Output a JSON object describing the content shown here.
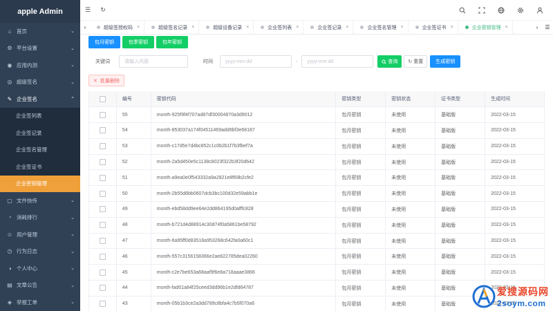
{
  "app": {
    "title": "apple Admin"
  },
  "sidebar": {
    "items_before": [
      {
        "label": "首页",
        "icon": "home-icon"
      },
      {
        "label": "平台设置",
        "icon": "settings-icon"
      },
      {
        "label": "应用内测",
        "icon": "app-icon"
      },
      {
        "label": "超级签名",
        "icon": "sign-icon"
      }
    ],
    "open_group": {
      "label": "企业签名",
      "icon": "edit-icon",
      "children": [
        {
          "label": "企业签列表",
          "active": false
        },
        {
          "label": "企业签记录",
          "active": false
        },
        {
          "label": "企业签名管理",
          "active": false
        },
        {
          "label": "企业签证书",
          "active": false
        },
        {
          "label": "企业密钥管理",
          "active": true
        }
      ]
    },
    "items_after": [
      {
        "label": "文件快传",
        "icon": "file-icon"
      },
      {
        "label": "消耗排行",
        "icon": "rank-icon"
      },
      {
        "label": "用户管理",
        "icon": "user-icon"
      },
      {
        "label": "行为日志",
        "icon": "log-icon"
      },
      {
        "label": "个人中心",
        "icon": "profile-icon"
      },
      {
        "label": "文章公告",
        "icon": "article-icon"
      },
      {
        "label": "举报工单",
        "icon": "report-icon"
      }
    ]
  },
  "tags": [
    {
      "label": "超级签授权码",
      "active": false
    },
    {
      "label": "超级签名记录",
      "active": false
    },
    {
      "label": "超级设备记录",
      "active": false
    },
    {
      "label": "企业签列表",
      "active": false
    },
    {
      "label": "企业签记录",
      "active": false
    },
    {
      "label": "企业签名管理",
      "active": false
    },
    {
      "label": "企业签证书",
      "active": false
    },
    {
      "label": "企业密钥管理",
      "active": true
    }
  ],
  "toolbar": {
    "monthly_key": "包月密钥",
    "quarterly_key": "包季密钥",
    "yearly_key": "包年密钥"
  },
  "filter": {
    "keyword_label": "关键词",
    "keyword_placeholder": "请输入内容",
    "time_label": "时间",
    "date_placeholder_start": "yyyy-mm-dd",
    "date_separator": "-",
    "date_placeholder_end": "yyyy-mm-dd",
    "search_label": "查询",
    "reset_label": "重置",
    "generate_label": "生成密钥"
  },
  "batch_delete_label": "批量删除",
  "table": {
    "headers": [
      "编号",
      "密钥代码",
      "密钥类型",
      "密钥状态",
      "证书类型",
      "生成时间"
    ],
    "rows": [
      [
        "55",
        "month-925f9f4f707ad87df30004870a3d9012",
        "包月密钥",
        "未使用",
        "基础版",
        "2022-03-15"
      ],
      [
        "54",
        "month-853037a174f04511469add9bf3e68187",
        "包月密钥",
        "未使用",
        "基础版",
        "2022-03-15"
      ],
      [
        "53",
        "month-c17d5e7d4bc852c1c0b2b1f7b3fbef7a",
        "包月密钥",
        "未使用",
        "基础版",
        "2022-03-15"
      ],
      [
        "52",
        "month-2a5d450e5c1138c8023f322b3f20d642",
        "包月密钥",
        "未使用",
        "基础版",
        "2022-03-15"
      ],
      [
        "51",
        "month-a9ea0e0f543332a9a2821e8f69b2cfe2",
        "包月密钥",
        "未使用",
        "基础版",
        "2022-03-15"
      ],
      [
        "50",
        "month-2b55d8bb0607dcb3bc100d32e59abb1e",
        "包月密钥",
        "未使用",
        "基础版",
        "2022-03-15"
      ],
      [
        "49",
        "month-ebd58dd9ee64e2dd864195d0afffc828",
        "包月密钥",
        "未使用",
        "基础版",
        "2022-03-15"
      ],
      [
        "48",
        "month-b721d4d88914c30d74f0a5861be58792",
        "包月密钥",
        "未使用",
        "基础版",
        "2022-03-15"
      ],
      [
        "47",
        "month-6a95ff0d83518a953268c642fa0a60c1",
        "包月密钥",
        "未使用",
        "基础版",
        "2022-03-15"
      ],
      [
        "46",
        "month-557c3156158366e2ae822785dea02260",
        "包月密钥",
        "未使用",
        "基础版",
        "2022-03-15"
      ],
      [
        "45",
        "month-c2e7be653a68aaf9f6e8a718aaae3866",
        "包月密钥",
        "未使用",
        "基础版",
        "2022-03-15"
      ],
      [
        "44",
        "month-fad01a84f25ceed3dd96b1e2dfd64787",
        "包月密钥",
        "未使用",
        "基础版",
        "2022-03-15"
      ],
      [
        "43",
        "month-05b1b3ce2a3dd789c8bfa4c7b5f070a6",
        "包月密钥",
        "未使用",
        "基础版",
        "2022-03-15"
      ]
    ]
  },
  "watermark": {
    "line1": "爱搜源码网",
    "line2": "2soym.com"
  },
  "colors": {
    "sidebar_bg": "#304156",
    "active_menu": "#f0a03a",
    "primary": "#1890ff",
    "success": "#13ce66",
    "active_tag": "#42b983",
    "danger": "#f56c6c"
  }
}
